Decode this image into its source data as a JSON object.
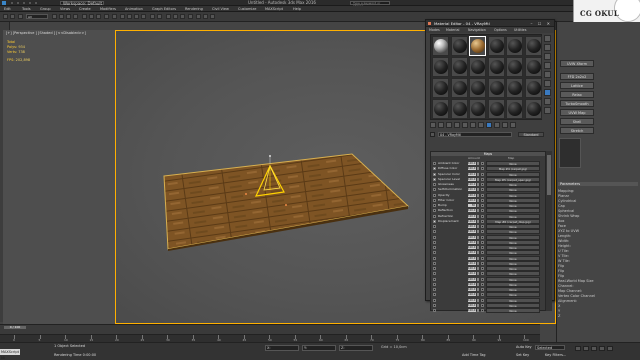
{
  "window": {
    "workspace": "Workspace: Default",
    "title": "Untitled - Autodesk 3ds Max 2016",
    "search_placeholder": "Type a keyword or phrase"
  },
  "menu": [
    "Edit",
    "Tools",
    "Group",
    "Views",
    "Create",
    "Modifiers",
    "Animation",
    "Graph Editors",
    "Rendering",
    "Civil View",
    "Customize",
    "MAXScript",
    "Help"
  ],
  "toolbar": {
    "selection_filter": "All"
  },
  "viewport": {
    "label": "[+] [Perspective ] [Shaded ] [<<Disabled>>]",
    "stats": [
      {
        "k": "Total",
        "v": ""
      },
      {
        "k": "Polys:",
        "v": "934"
      },
      {
        "k": "Verts:",
        "v": "738"
      },
      {
        "k": "FPS:",
        "v": "202,898"
      }
    ]
  },
  "timeline": {
    "slider": "0 / 100",
    "ticks": [
      "0",
      "5",
      "10",
      "15",
      "20",
      "25",
      "30",
      "35",
      "40",
      "45",
      "50",
      "55",
      "60",
      "65",
      "70",
      "75",
      "80",
      "85",
      "90",
      "95",
      "100"
    ]
  },
  "status": {
    "script_label": "MAXScript Mi",
    "selected_count": "1 Object Selected",
    "render_time": "Rendering Time 0:00:00",
    "x_label": "X:",
    "y_label": "Y:",
    "z_label": "Z:",
    "grid": "Grid = 10,0cm",
    "add_time_tag": "Add Time Tag",
    "auto_key": "Auto Key",
    "selected_dropdown": "Selected",
    "set_key": "Set Key",
    "key_filters": "Key Filters..."
  },
  "right_panel": {
    "logo": "CG OKUL",
    "buttons": [
      "UVW Xform",
      "FFD 2x2x2",
      "Lattice",
      "Relax",
      "TurboSmooth",
      "UVW Map",
      "Shell",
      "Stretch"
    ],
    "rollout": "Parameters",
    "rows": [
      "Mapping:",
      "Planar",
      "Cylindrical",
      "Cap",
      "Spherical",
      "Shrink Wrap",
      "Box",
      "Face",
      "XYZ to UVW",
      "Length:",
      "Width:",
      "Height:",
      "U Tile:",
      "V Tile:",
      "W Tile:",
      "Flip",
      "Flip",
      "Flip",
      "Real-World Map Size",
      "Channel:",
      "Map Channel:",
      "Vertex Color Channel",
      "Alignment:",
      "X",
      "Y",
      "Z"
    ]
  },
  "material_editor": {
    "title": "Material Editor - 04 - VRayMtl",
    "menu": [
      "Modes",
      "Material",
      "Navigation",
      "Options",
      "Utilities"
    ],
    "slots": [
      "chrome",
      "dark",
      "wood",
      "dark",
      "dark",
      "dark",
      "dark",
      "dark",
      "dark",
      "dark",
      "dark",
      "dark",
      "dark",
      "dark",
      "dark",
      "dark",
      "dark",
      "dark",
      "dark",
      "dark",
      "dark",
      "dark",
      "dark",
      "dark"
    ],
    "selected_slot": 2,
    "material_name": "04 - VRayMtl",
    "material_type": "Standard",
    "maps": {
      "header": "Maps",
      "col_amount": "Amount",
      "col_map": "Map",
      "rows": [
        {
          "label": "Ambient Color",
          "checked": false,
          "amount": "100,0",
          "map": "None"
        },
        {
          "label": "Diffuse Color",
          "checked": true,
          "amount": "100,0",
          "map": "Map #4 (carpet.jpg)"
        },
        {
          "label": "Specular Color",
          "checked": true,
          "amount": "100,0",
          "map": "None"
        },
        {
          "label": "Specular Level",
          "checked": true,
          "amount": "100,0",
          "map": "Map #5 (carpet_spec.jpg)"
        },
        {
          "label": "Glossiness",
          "checked": false,
          "amount": "100,0",
          "map": "None"
        },
        {
          "label": "Self-Illumination",
          "checked": false,
          "amount": "100,0",
          "map": "None"
        },
        {
          "label": "Opacity",
          "checked": false,
          "amount": "100,0",
          "map": "None"
        },
        {
          "label": "Filter Color",
          "checked": false,
          "amount": "100,0",
          "map": "None"
        },
        {
          "label": "Bump",
          "checked": false,
          "amount": "30",
          "map": "None"
        },
        {
          "label": "Reflection",
          "checked": false,
          "amount": "100,0",
          "map": "None"
        },
        {
          "label": "Refraction",
          "checked": false,
          "amount": "100,0",
          "map": "None"
        },
        {
          "label": "Displacement",
          "checked": true,
          "amount": "100,0",
          "map": "Map #6 (carpet_disp.jpg)"
        },
        {
          "label": "",
          "checked": false,
          "amount": "100,0",
          "map": "None"
        },
        {
          "label": "",
          "checked": false,
          "amount": "100,0",
          "map": "None"
        },
        {
          "label": "",
          "checked": false,
          "amount": "100,0",
          "map": "None"
        },
        {
          "label": "",
          "checked": false,
          "amount": "100,0",
          "map": "None"
        },
        {
          "label": "",
          "checked": false,
          "amount": "100,0",
          "map": "None"
        },
        {
          "label": "",
          "checked": false,
          "amount": "100,0",
          "map": "None"
        },
        {
          "label": "",
          "checked": false,
          "amount": "100,0",
          "map": "None"
        },
        {
          "label": "",
          "checked": false,
          "amount": "100,0",
          "map": "None"
        },
        {
          "label": "",
          "checked": false,
          "amount": "100,0",
          "map": "None"
        },
        {
          "label": "",
          "checked": false,
          "amount": "100,0",
          "map": "None"
        },
        {
          "label": "",
          "checked": false,
          "amount": "100,0",
          "map": "None"
        },
        {
          "label": "",
          "checked": false,
          "amount": "100,0",
          "map": "None"
        },
        {
          "label": "",
          "checked": false,
          "amount": "100,0",
          "map": "None"
        },
        {
          "label": "",
          "checked": false,
          "amount": "100,0",
          "map": "None"
        },
        {
          "label": "",
          "checked": false,
          "amount": "100,0",
          "map": "None"
        },
        {
          "label": "",
          "checked": false,
          "amount": "100,0",
          "map": "None"
        },
        {
          "label": "",
          "checked": false,
          "amount": "100,0",
          "map": "None"
        }
      ]
    }
  },
  "colors": {
    "accent": "#ffb000",
    "selection_gold": "#ffcc33",
    "wood": "#8a5a24"
  }
}
